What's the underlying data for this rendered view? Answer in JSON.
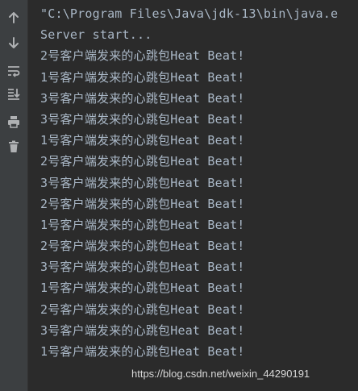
{
  "toolbar": {
    "buttons": [
      {
        "icon": "arrow-up-icon",
        "label": "Up the stack trace"
      },
      {
        "icon": "arrow-down-icon",
        "label": "Down the stack trace"
      },
      {
        "icon": "soft-wrap-icon",
        "label": "Soft-wrap"
      },
      {
        "icon": "scroll-to-end-icon",
        "label": "Scroll to the end"
      },
      {
        "icon": "print-icon",
        "label": "Print"
      },
      {
        "icon": "trash-icon",
        "label": "Clear all"
      }
    ]
  },
  "console": {
    "lines": [
      "\"C:\\Program Files\\Java\\jdk-13\\bin\\java.e",
      "Server start...",
      "2号客户端发来的心跳包Heat Beat!",
      "1号客户端发来的心跳包Heat Beat!",
      "3号客户端发来的心跳包Heat Beat!",
      "3号客户端发来的心跳包Heat Beat!",
      "1号客户端发来的心跳包Heat Beat!",
      "2号客户端发来的心跳包Heat Beat!",
      "3号客户端发来的心跳包Heat Beat!",
      "2号客户端发来的心跳包Heat Beat!",
      "1号客户端发来的心跳包Heat Beat!",
      "2号客户端发来的心跳包Heat Beat!",
      "3号客户端发来的心跳包Heat Beat!",
      "1号客户端发来的心跳包Heat Beat!",
      "2号客户端发来的心跳包Heat Beat!",
      "3号客户端发来的心跳包Heat Beat!",
      "1号客户端发来的心跳包Heat Beat!"
    ]
  },
  "watermark": "https://blog.csdn.net/weixin_44290191",
  "colors": {
    "background": "#2b2b2b",
    "toolbar": "#3c3f41",
    "text": "#a9b7c6",
    "icon": "#afb1b3"
  }
}
